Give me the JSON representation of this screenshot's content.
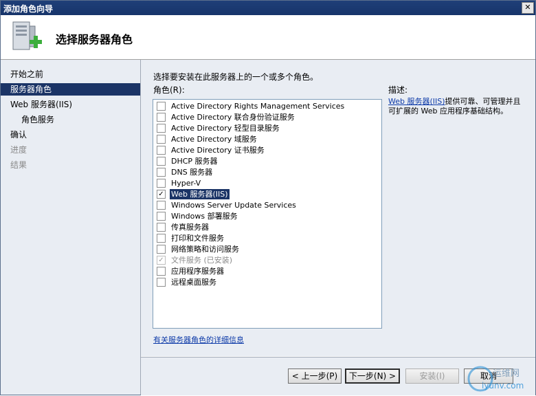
{
  "window": {
    "title": "添加角色向导",
    "close_label": "✕"
  },
  "header": {
    "title": "选择服务器角色",
    "icon": "server-add-icon"
  },
  "sidebar": {
    "items": [
      {
        "label": "开始之前",
        "state": "normal"
      },
      {
        "label": "服务器角色",
        "state": "active"
      },
      {
        "label": "Web 服务器(IIS)",
        "state": "normal"
      },
      {
        "label": "角色服务",
        "state": "sub"
      },
      {
        "label": "确认",
        "state": "normal"
      },
      {
        "label": "进度",
        "state": "disabled"
      },
      {
        "label": "结果",
        "state": "disabled"
      }
    ]
  },
  "main": {
    "instruction": "选择要安装在此服务器上的一个或多个角色。",
    "roles_label": "角色(R):",
    "description_label": "描述:",
    "description": {
      "link": "Web 服务器(IIS)",
      "text": "提供可靠、可管理并且可扩展的 Web 应用程序基础结构。"
    },
    "more_link": "有关服务器角色的详细信息",
    "roles": [
      {
        "label": "Active Directory Rights Management Services",
        "checked": false
      },
      {
        "label": "Active Directory 联合身份验证服务",
        "checked": false
      },
      {
        "label": "Active Directory 轻型目录服务",
        "checked": false
      },
      {
        "label": "Active Directory 域服务",
        "checked": false
      },
      {
        "label": "Active Directory 证书服务",
        "checked": false
      },
      {
        "label": "DHCP 服务器",
        "checked": false
      },
      {
        "label": "DNS 服务器",
        "checked": false
      },
      {
        "label": "Hyper-V",
        "checked": false
      },
      {
        "label": "Web 服务器(IIS)",
        "checked": true,
        "selected": true
      },
      {
        "label": "Windows Server Update Services",
        "checked": false
      },
      {
        "label": "Windows 部署服务",
        "checked": false
      },
      {
        "label": "传真服务器",
        "checked": false
      },
      {
        "label": "打印和文件服务",
        "checked": false
      },
      {
        "label": "网络策略和访问服务",
        "checked": false
      },
      {
        "label": "文件服务  (已安装)",
        "checked": true,
        "disabled": true
      },
      {
        "label": "应用程序服务器",
        "checked": false
      },
      {
        "label": "远程桌面服务",
        "checked": false
      }
    ]
  },
  "footer": {
    "prev_label": "< 上一步(P)",
    "next_label": "下一步(N) >",
    "install_label": "安装(I)",
    "cancel_label": "取消"
  },
  "watermark": {
    "text_cn": "运维网",
    "text_en": "iyunv.com"
  },
  "colors": {
    "titlebar": "#1f3f78",
    "selection": "#1b3466",
    "panel": "#e9edf3",
    "link": "#0d3aa8"
  }
}
